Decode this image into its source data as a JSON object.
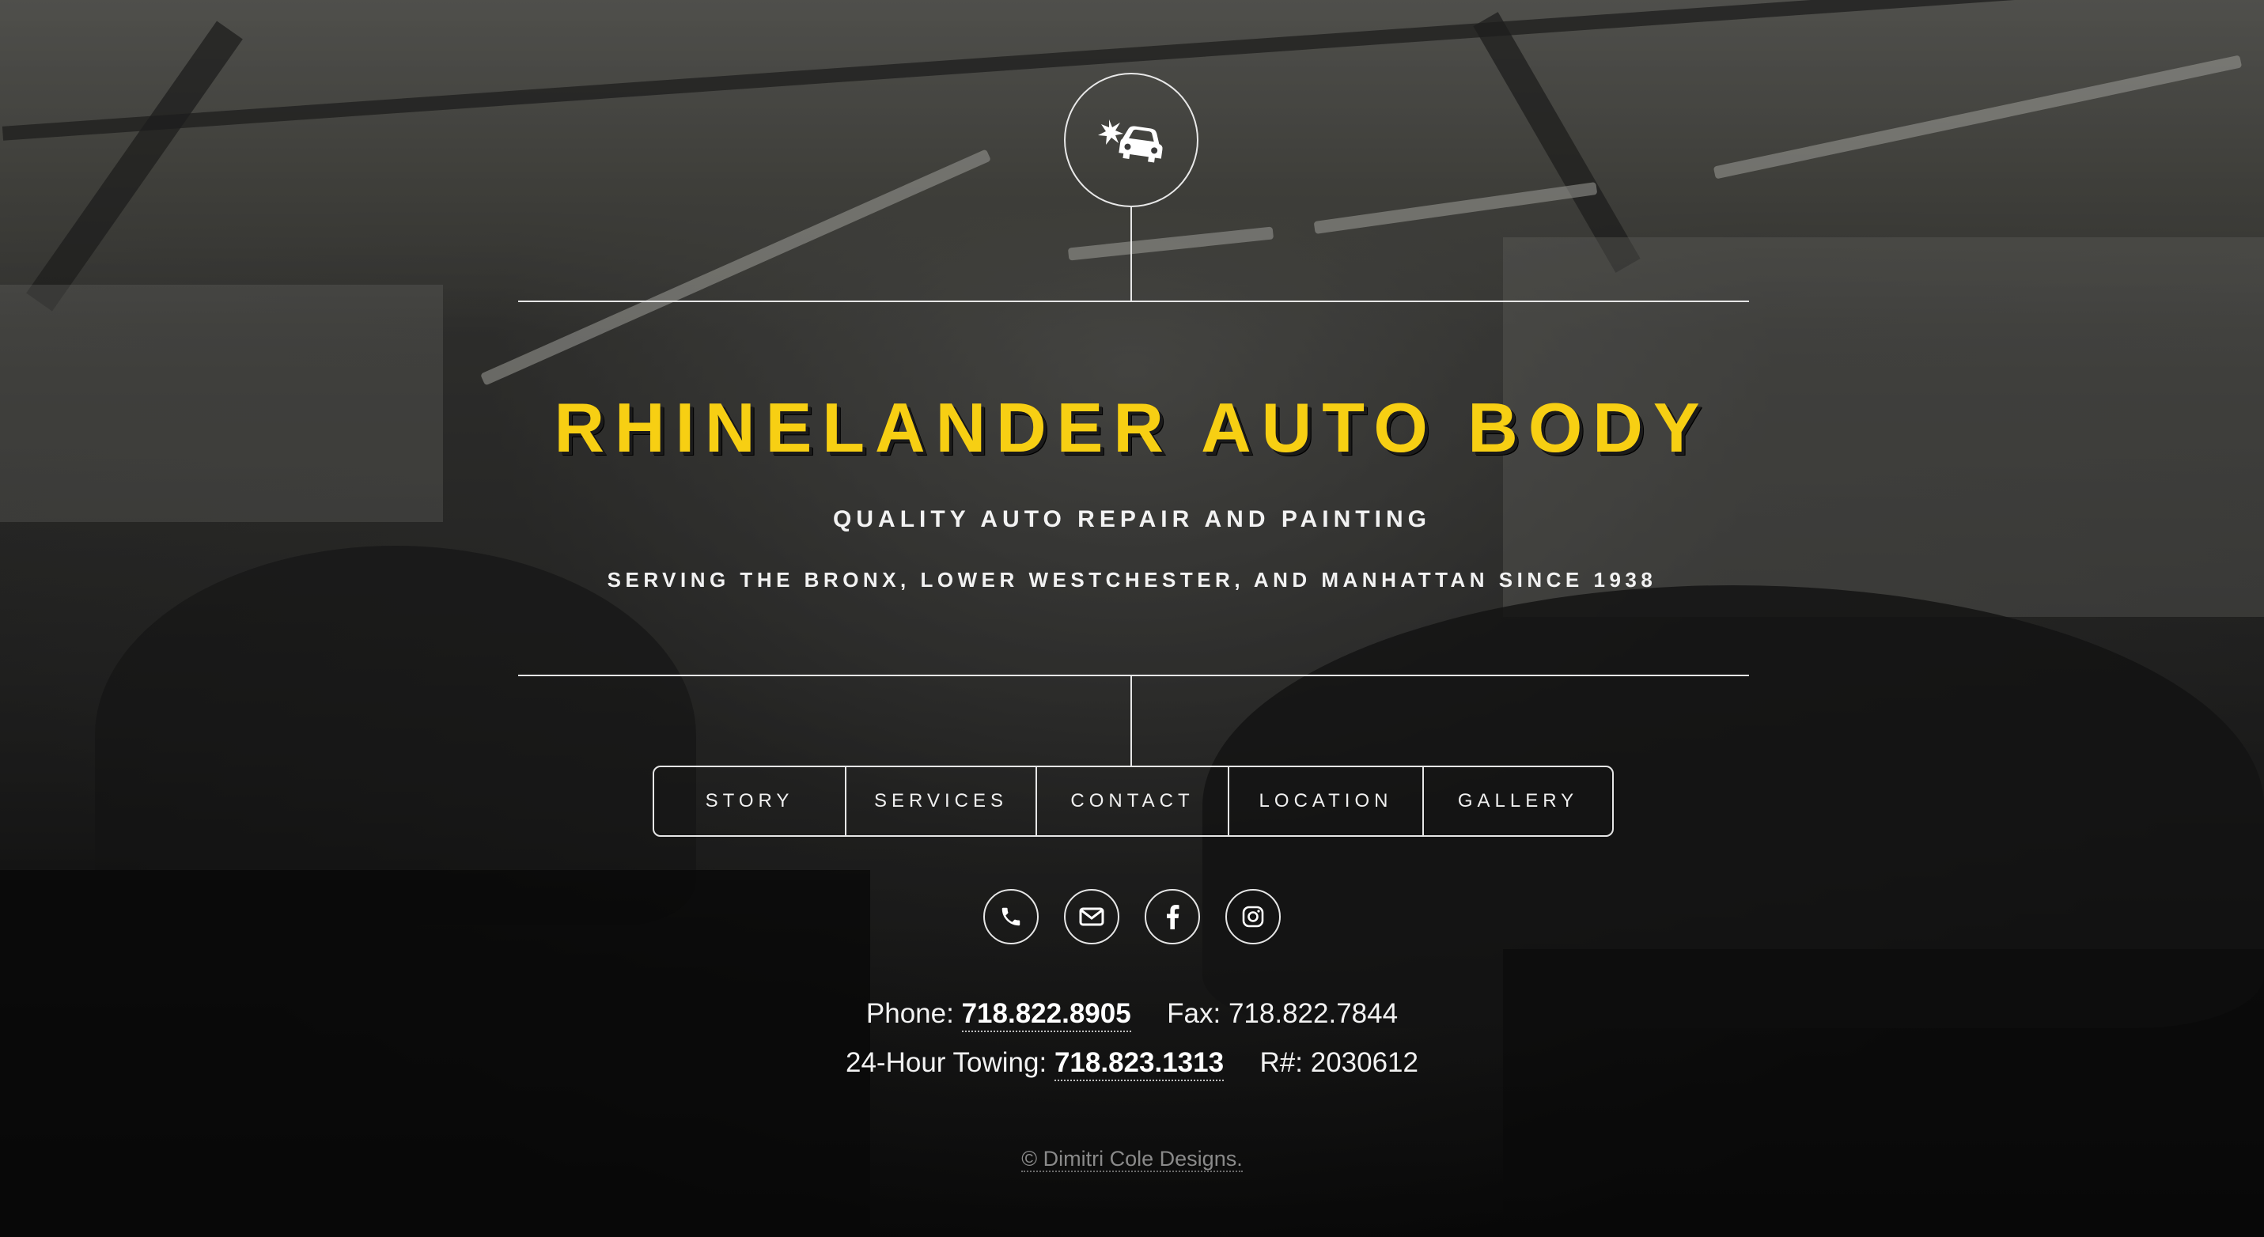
{
  "site": {
    "title": "RHINELANDER AUTO BODY",
    "tagline": "QUALITY AUTO REPAIR AND PAINTING",
    "service_area": "SERVING THE BRONX, LOWER WESTCHESTER, AND MANHATTAN SINCE 1938",
    "logo_icon": "car-crash-icon",
    "accent_color": "#f7cf13"
  },
  "nav": {
    "items": [
      {
        "label": "STORY"
      },
      {
        "label": "SERVICES"
      },
      {
        "label": "CONTACT"
      },
      {
        "label": "LOCATION"
      },
      {
        "label": "GALLERY"
      }
    ]
  },
  "social": {
    "icons": [
      "phone-icon",
      "envelope-icon",
      "facebook-icon",
      "instagram-icon"
    ]
  },
  "contact": {
    "phone_label": "Phone:",
    "phone": "718.822.8905",
    "fax_label": "Fax:",
    "fax": "718.822.7844",
    "towing_label": "24-Hour Towing:",
    "towing": "718.823.1313",
    "reg_label": "R#:",
    "reg": "2030612"
  },
  "footer": {
    "credit": "© Dimitri Cole Designs."
  }
}
